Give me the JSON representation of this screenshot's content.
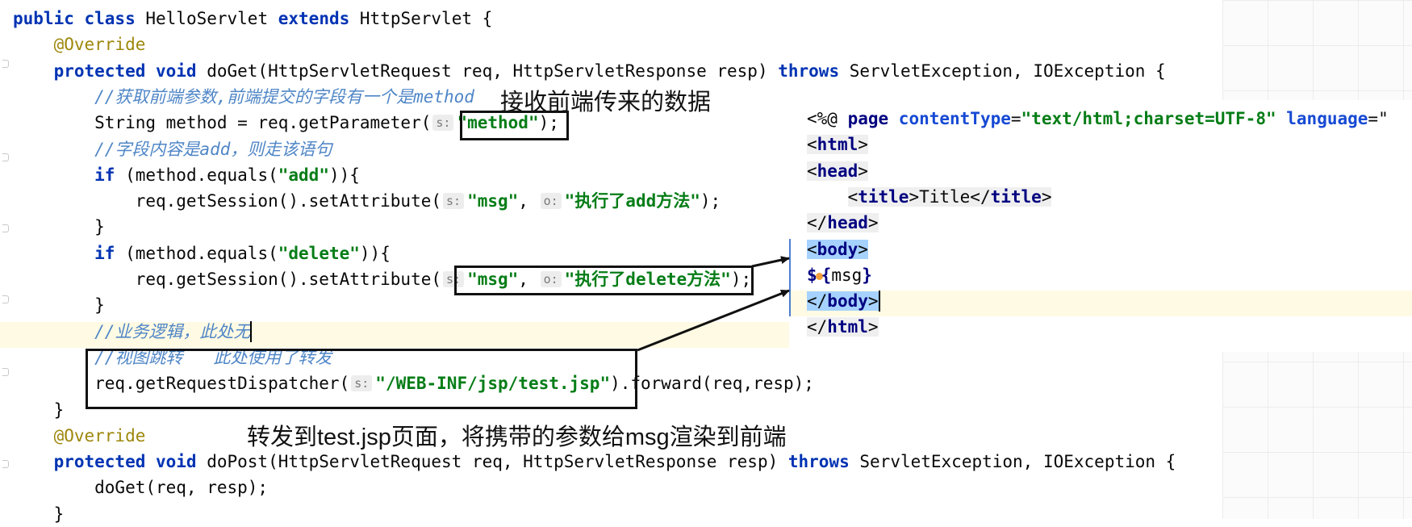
{
  "java": {
    "lines": [
      {
        "parts": [
          {
            "t": "public class ",
            "c": "kw"
          },
          {
            "t": "HelloServlet ",
            "c": ""
          },
          {
            "t": "extends ",
            "c": "kw"
          },
          {
            "t": "HttpServlet {",
            "c": ""
          }
        ]
      },
      {
        "parts": [
          {
            "t": "    @Override",
            "c": "ann"
          }
        ]
      },
      {
        "parts": [
          {
            "t": "    protected void ",
            "c": "kw"
          },
          {
            "t": "doGet(HttpServletRequest req, HttpServletResponse resp) ",
            "c": ""
          },
          {
            "t": "throws ",
            "c": "kw"
          },
          {
            "t": "ServletException, IOException {",
            "c": ""
          }
        ]
      },
      {
        "parts": [
          {
            "t": "        //获取前端参数,前端提交的字段有一个是method",
            "c": "cmt"
          }
        ]
      },
      {
        "parts": [
          {
            "t": "        String method = req.getParameter(",
            "c": ""
          },
          {
            "t": "s:",
            "c": "hint"
          },
          {
            "t": "\"method\"",
            "c": "str"
          },
          {
            "t": ");",
            "c": ""
          }
        ]
      },
      {
        "parts": [
          {
            "t": "        //字段内容是add，则走该语句",
            "c": "cmt"
          }
        ]
      },
      {
        "parts": [
          {
            "t": "        ",
            "c": ""
          },
          {
            "t": "if ",
            "c": "kw"
          },
          {
            "t": "(method.equals(",
            "c": ""
          },
          {
            "t": "\"add\"",
            "c": "str"
          },
          {
            "t": ")){",
            "c": ""
          }
        ]
      },
      {
        "parts": [
          {
            "t": "            req.getSession().setAttribute(",
            "c": ""
          },
          {
            "t": "s:",
            "c": "hint"
          },
          {
            "t": "\"msg\"",
            "c": "str"
          },
          {
            "t": ", ",
            "c": ""
          },
          {
            "t": "o:",
            "c": "hint"
          },
          {
            "t": "\"执行了add方法\"",
            "c": "str"
          },
          {
            "t": ");",
            "c": ""
          }
        ]
      },
      {
        "parts": [
          {
            "t": "        }",
            "c": ""
          }
        ]
      },
      {
        "parts": [
          {
            "t": "        ",
            "c": ""
          },
          {
            "t": "if ",
            "c": "kw"
          },
          {
            "t": "(method.equals(",
            "c": ""
          },
          {
            "t": "\"delete\"",
            "c": "str"
          },
          {
            "t": ")){",
            "c": ""
          }
        ]
      },
      {
        "parts": [
          {
            "t": "            req.getSession().setAttribute(",
            "c": ""
          },
          {
            "t": "s:",
            "c": "hint"
          },
          {
            "t": "\"msg\"",
            "c": "str"
          },
          {
            "t": ", ",
            "c": ""
          },
          {
            "t": "o:",
            "c": "hint"
          },
          {
            "t": "\"执行了delete方法\"",
            "c": "str"
          },
          {
            "t": ");",
            "c": ""
          }
        ]
      },
      {
        "parts": [
          {
            "t": "        }",
            "c": ""
          }
        ]
      },
      {
        "parts": [
          {
            "t": "        //业务逻辑，此处无",
            "c": "cmt"
          },
          {
            "t": "",
            "c": "caret"
          }
        ]
      },
      {
        "parts": [
          {
            "t": "        //视图跳转   此处使用了转发",
            "c": "cmt"
          }
        ]
      },
      {
        "parts": [
          {
            "t": "        req.getRequestDispatcher(",
            "c": ""
          },
          {
            "t": "s:",
            "c": "hint"
          },
          {
            "t": "\"/WEB-INF/jsp/test.jsp\"",
            "c": "str"
          },
          {
            "t": ").forward(req,resp);",
            "c": ""
          }
        ]
      },
      {
        "parts": [
          {
            "t": "    }",
            "c": ""
          }
        ]
      },
      {
        "parts": [
          {
            "t": "    @Override",
            "c": "ann"
          }
        ]
      },
      {
        "parts": [
          {
            "t": "    protected void ",
            "c": "kw"
          },
          {
            "t": "doPost(HttpServletRequest req, HttpServletResponse resp) ",
            "c": ""
          },
          {
            "t": "throws ",
            "c": "kw"
          },
          {
            "t": "ServletException, IOException {",
            "c": ""
          }
        ]
      },
      {
        "parts": [
          {
            "t": "        doGet(req, resp);",
            "c": ""
          }
        ]
      },
      {
        "parts": [
          {
            "t": "    }",
            "c": ""
          }
        ]
      }
    ]
  },
  "jsp": {
    "lines": [
      {
        "parts": [
          {
            "t": "<%@ ",
            "c": ""
          },
          {
            "t": "page ",
            "c": "tagname"
          },
          {
            "t": "contentType",
            "c": "attr"
          },
          {
            "t": "=",
            "c": ""
          },
          {
            "t": "\"text/html;charset=UTF-8\"",
            "c": "aval"
          },
          {
            "t": " ",
            "c": ""
          },
          {
            "t": "language",
            "c": "attr"
          },
          {
            "t": "=\"",
            "c": ""
          }
        ]
      },
      {
        "parts": [
          {
            "t": "<",
            "c": "tag"
          },
          {
            "t": "html",
            "c": "tag tagname"
          },
          {
            "t": ">",
            "c": "tag"
          }
        ]
      },
      {
        "parts": [
          {
            "t": "<",
            "c": "tag"
          },
          {
            "t": "head",
            "c": "tag tagname"
          },
          {
            "t": ">",
            "c": "tag"
          }
        ]
      },
      {
        "parts": [
          {
            "t": "    ",
            "c": ""
          },
          {
            "t": "<",
            "c": "tag"
          },
          {
            "t": "title",
            "c": "tag tagname"
          },
          {
            "t": ">Title</",
            "c": "tag"
          },
          {
            "t": "title",
            "c": "tag tagname"
          },
          {
            "t": ">",
            "c": "tag"
          }
        ]
      },
      {
        "parts": [
          {
            "t": "</",
            "c": "tag"
          },
          {
            "t": "head",
            "c": "tag tagname"
          },
          {
            "t": ">",
            "c": "tag"
          }
        ]
      },
      {
        "parts": [
          {
            "t": "<",
            "c": "sel"
          },
          {
            "t": "body",
            "c": "sel tagname"
          },
          {
            "t": ">",
            "c": "sel"
          }
        ]
      },
      {
        "parts": [
          {
            "t": "$",
            "c": "tagname"
          },
          {
            "t": "",
            "c": "warn-dot"
          },
          {
            "t": "{",
            "c": "tagname"
          },
          {
            "t": "msg",
            "c": ""
          },
          {
            "t": "}",
            "c": "tagname"
          }
        ]
      },
      {
        "parts": [
          {
            "t": "</",
            "c": "sel"
          },
          {
            "t": "body",
            "c": "sel tagname"
          },
          {
            "t": ">",
            "c": "sel"
          },
          {
            "t": "",
            "c": "caret"
          }
        ]
      },
      {
        "parts": [
          {
            "t": "</",
            "c": "tag"
          },
          {
            "t": "html",
            "c": "tag tagname"
          },
          {
            "t": ">",
            "c": "tag"
          }
        ]
      }
    ]
  },
  "notes": {
    "receive": "接收前端传来的数据",
    "forward": "转发到test.jsp页面，将携带的参数给msg渲染到前端"
  },
  "colors": {
    "keyword": "#0033b3",
    "string": "#067d17",
    "annotation": "#9e880d",
    "comment": "#4f86c6",
    "selection": "#a6d2ff",
    "current_line": "#fffae3"
  }
}
